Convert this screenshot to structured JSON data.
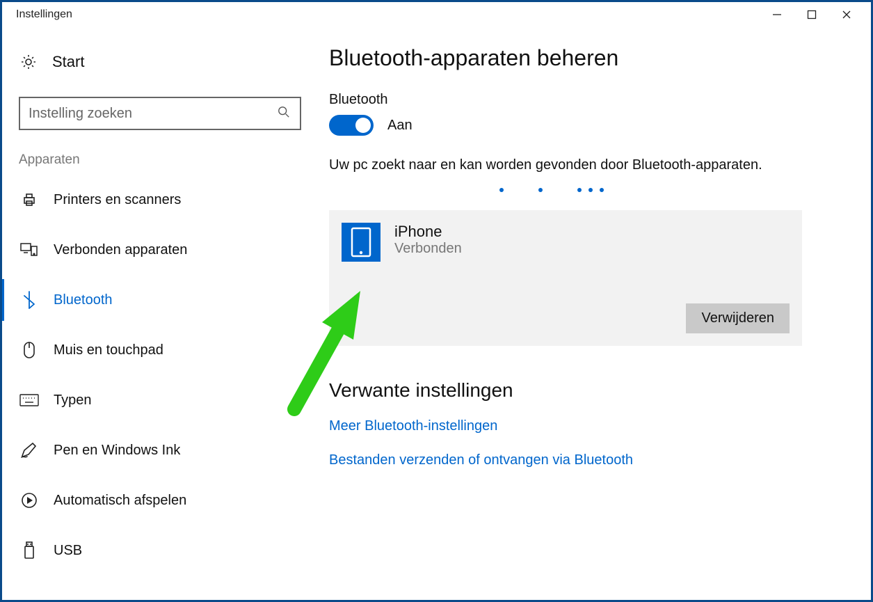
{
  "window": {
    "title": "Instellingen"
  },
  "sidebar": {
    "start_label": "Start",
    "search_placeholder": "Instelling zoeken",
    "section_label": "Apparaten",
    "items": [
      {
        "label": "Printers en scanners"
      },
      {
        "label": "Verbonden apparaten"
      },
      {
        "label": "Bluetooth"
      },
      {
        "label": "Muis en touchpad"
      },
      {
        "label": "Typen"
      },
      {
        "label": "Pen en Windows Ink"
      },
      {
        "label": "Automatisch afspelen"
      },
      {
        "label": "USB"
      }
    ]
  },
  "main": {
    "page_title": "Bluetooth-apparaten beheren",
    "toggle_section_label": "Bluetooth",
    "toggle_state_label": "Aan",
    "status_text": "Uw pc zoekt naar en kan worden gevonden door Bluetooth-apparaten.",
    "device": {
      "name": "iPhone",
      "status": "Verbonden",
      "remove_label": "Verwijderen"
    },
    "related_title": "Verwante instellingen",
    "links": [
      "Meer Bluetooth-instellingen",
      "Bestanden verzenden of ontvangen via Bluetooth"
    ]
  }
}
